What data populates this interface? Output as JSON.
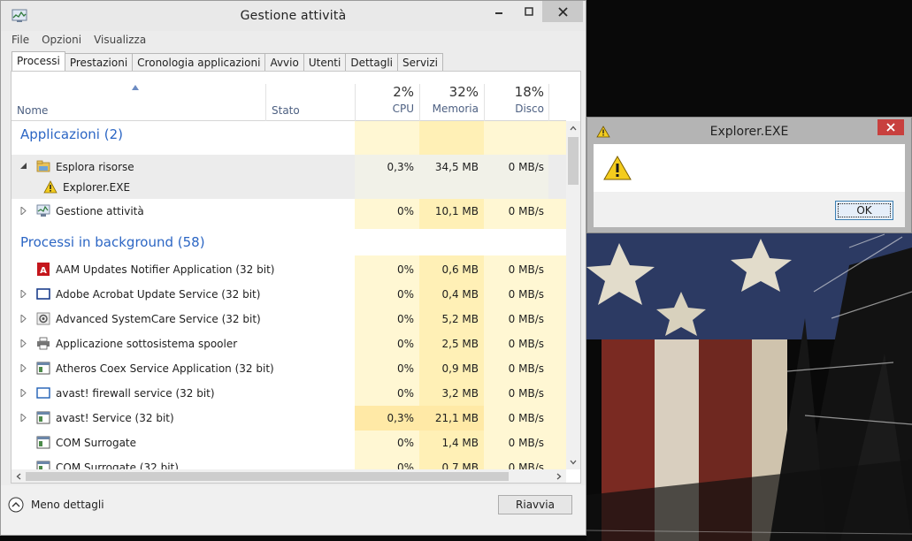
{
  "window": {
    "title": "Gestione attività",
    "menu": [
      "File",
      "Opzioni",
      "Visualizza"
    ],
    "tabs": [
      {
        "label": "Processi",
        "active": true
      },
      {
        "label": "Prestazioni",
        "active": false
      },
      {
        "label": "Cronologia applicazioni",
        "active": false
      },
      {
        "label": "Avvio",
        "active": false
      },
      {
        "label": "Utenti",
        "active": false
      },
      {
        "label": "Dettagli",
        "active": false
      },
      {
        "label": "Servizi",
        "active": false
      }
    ]
  },
  "columns": {
    "name": "Nome",
    "status": "Stato",
    "cpu": {
      "percent": "2%",
      "label": "CPU"
    },
    "memory": {
      "percent": "32%",
      "label": "Memoria"
    },
    "disk": {
      "percent": "18%",
      "label": "Disco"
    }
  },
  "groups": {
    "apps": "Applicazioni (2)",
    "background": "Processi in background (58)"
  },
  "app_rows": [
    {
      "name": "Esplora risorse",
      "cpu": "0,3%",
      "memory": "34,5 MB",
      "disk": "0 MB/s",
      "icon": "folder-icon",
      "expanded": true
    },
    {
      "name": "Explorer.EXE",
      "icon": "warning-icon",
      "child": true
    },
    {
      "name": "Gestione attività",
      "cpu": "0%",
      "memory": "10,1 MB",
      "disk": "0 MB/s",
      "icon": "task-manager-icon"
    }
  ],
  "bg_rows": [
    {
      "name": "AAM Updates Notifier Application (32 bit)",
      "cpu": "0%",
      "memory": "0,6 MB",
      "disk": "0 MB/s",
      "icon": "adobe-icon",
      "expander": false
    },
    {
      "name": "Adobe Acrobat Update Service (32 bit)",
      "cpu": "0%",
      "memory": "0,4 MB",
      "disk": "0 MB/s",
      "icon": "window-icon",
      "expander": true
    },
    {
      "name": "Advanced SystemCare Service (32 bit)",
      "cpu": "0%",
      "memory": "5,2 MB",
      "disk": "0 MB/s",
      "icon": "gear-icon",
      "expander": true
    },
    {
      "name": "Applicazione sottosistema spooler",
      "cpu": "0%",
      "memory": "2,5 MB",
      "disk": "0 MB/s",
      "icon": "printer-icon",
      "expander": true
    },
    {
      "name": "Atheros Coex Service Application (32 bit)",
      "cpu": "0%",
      "memory": "0,9 MB",
      "disk": "0 MB/s",
      "icon": "service-icon",
      "expander": true
    },
    {
      "name": "avast! firewall service (32 bit)",
      "cpu": "0%",
      "memory": "3,2 MB",
      "disk": "0 MB/s",
      "icon": "window-icon",
      "expander": true
    },
    {
      "name": "avast! Service (32 bit)",
      "cpu": "0,3%",
      "memory": "21,1 MB",
      "disk": "0 MB/s",
      "icon": "service-icon",
      "expander": true
    },
    {
      "name": "COM Surrogate",
      "cpu": "0%",
      "memory": "1,4 MB",
      "disk": "0 MB/s",
      "icon": "service-icon",
      "expander": false
    },
    {
      "name": "COM Surrogate (32 bit)",
      "cpu": "0%",
      "memory": "0,7 MB",
      "disk": "0 MB/s",
      "icon": "service-icon",
      "expander": false
    }
  ],
  "footer": {
    "fewer_details": "Meno dettagli",
    "end_task": "Riavvia"
  },
  "dialog": {
    "title": "Explorer.EXE",
    "message": "",
    "ok": "OK"
  },
  "colors": {
    "accent_blue": "#2c66c4",
    "column_tint": "#fff7d3",
    "memory_tint": "#fff0b6",
    "dialog_close": "#c8403e"
  }
}
